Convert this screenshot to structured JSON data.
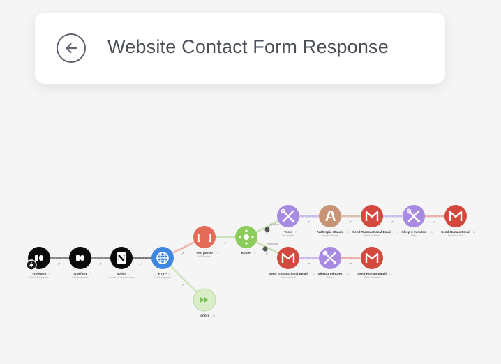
{
  "scenario": {
    "title": "Website Contact Form Response"
  },
  "icons": {
    "back": "arrow-left-circle-icon"
  },
  "colors": {
    "typeform": "#0b0b0b",
    "notion": "#0b0b0b",
    "http": "#3f86e0",
    "text_parser": "#e36b57",
    "router": "#8ccc5b",
    "tools": "#a98ae2",
    "anthropic": "#c79576",
    "gmail": "#d4493e",
    "ignore": "#d9edc8"
  },
  "modules": [
    {
      "id": "typeform1",
      "title": "Typeform",
      "subtitle": "Watch Responses",
      "num": "1",
      "icon": "typeform-icon",
      "color": "#0b0b0b"
    },
    {
      "id": "typeform2",
      "title": "Typeform",
      "subtitle": "List Responses",
      "num": "2",
      "icon": "typeform-icon",
      "color": "#0b0b0b"
    },
    {
      "id": "notion",
      "title": "Notion",
      "subtitle": "Create a Database Item",
      "num": "3",
      "icon": "notion-icon",
      "color": "#0b0b0b"
    },
    {
      "id": "http",
      "title": "HTTP",
      "subtitle": "Make a request",
      "num": "4",
      "icon": "globe-icon",
      "color": "#3f86e0"
    },
    {
      "id": "parser",
      "title": "Text parser",
      "subtitle": "HTML to text",
      "num": "5",
      "icon": "brackets-icon",
      "color": "#e36b57"
    },
    {
      "id": "router",
      "title": "Router",
      "subtitle": "",
      "num": "6",
      "icon": "router-icon",
      "color": "#8ccc5b"
    },
    {
      "id": "tools1",
      "title": "Tools",
      "subtitle": "Set variable",
      "num": "7",
      "icon": "tools-icon",
      "color": "#a98ae2"
    },
    {
      "id": "claude",
      "title": "Anthropic Claude",
      "subtitle": "Create a Prompt",
      "num": "8",
      "icon": "anthropic-icon",
      "color": "#c79576"
    },
    {
      "id": "gmail1",
      "title": "Send Transactional Email",
      "subtitle": "Send an Email",
      "num": "9",
      "icon": "gmail-icon",
      "color": "#d4493e"
    },
    {
      "id": "tools2",
      "title": "Sleep 3 minutes",
      "subtitle": "Sleep",
      "num": "10",
      "icon": "tools-icon",
      "color": "#a98ae2"
    },
    {
      "id": "gmail2",
      "title": "Send Human Email",
      "subtitle": "Send an Email",
      "num": "11",
      "icon": "gmail-icon",
      "color": "#d4493e"
    },
    {
      "id": "gmail3",
      "title": "Send Transactional Email",
      "subtitle": "Send an Email",
      "num": "12",
      "icon": "gmail-icon",
      "color": "#d4493e"
    },
    {
      "id": "tools3",
      "title": "Sleep 3 minutes",
      "subtitle": "Sleep",
      "num": "13",
      "icon": "tools-icon",
      "color": "#a98ae2"
    },
    {
      "id": "gmail4",
      "title": "Send Human Email",
      "subtitle": "Send an Email",
      "num": "14",
      "icon": "gmail-icon",
      "color": "#d4493e"
    },
    {
      "id": "ignore",
      "title": "Ignore",
      "subtitle": "",
      "num": "15",
      "icon": "skip-icon",
      "color": "#d9edc8"
    }
  ],
  "routes": [
    {
      "id": "route-top",
      "label": "1st Route"
    },
    {
      "id": "route-bottom",
      "label": "2nd Route"
    }
  ]
}
